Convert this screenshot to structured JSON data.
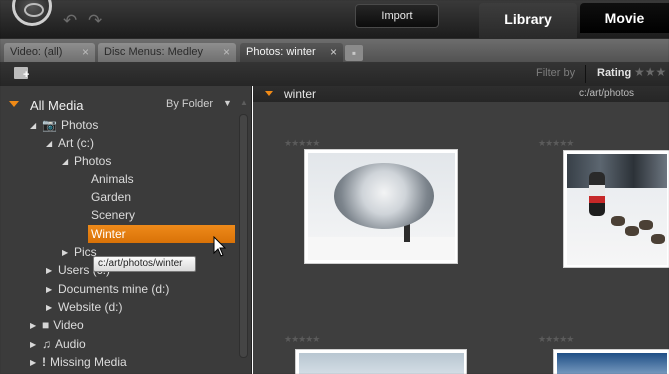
{
  "header": {
    "import_label": "Import",
    "tabs": [
      {
        "label": "Library",
        "active": true
      },
      {
        "label": "Movie",
        "active": false
      }
    ],
    "logo_icon": "app-logo-icon",
    "undo_icon": "undo-icon",
    "redo_icon": "redo-icon"
  },
  "library_tabs": [
    {
      "label": "Video: (all)",
      "active": false
    },
    {
      "label": "Disc Menus: Medley",
      "active": false
    },
    {
      "label": "Photos: winter",
      "active": true
    }
  ],
  "toolbar": {
    "filter_label": "Filter by",
    "rating_label": "Rating",
    "rating_stars": "★★★"
  },
  "tree": {
    "root_label": "All Media",
    "view_mode": "By Folder",
    "items": [
      {
        "label": "Photos",
        "icon": "camera-icon"
      },
      {
        "label": "Art (c:)"
      },
      {
        "label": "Photos"
      },
      {
        "label": "Animals"
      },
      {
        "label": "Garden"
      },
      {
        "label": "Scenery"
      },
      {
        "label": "Winter",
        "selected": true
      },
      {
        "label": "Pics"
      },
      {
        "label": "Users (c:)"
      },
      {
        "label": "Documents mine (d:)"
      },
      {
        "label": "Website (d:)"
      },
      {
        "label": "Video",
        "icon": "video-icon"
      },
      {
        "label": "Audio",
        "icon": "music-note-icon"
      },
      {
        "label": "Missing Media",
        "icon": "exclamation-icon"
      }
    ],
    "tooltip": "c:/art/photos/winter"
  },
  "content": {
    "folder_name": "winter",
    "folder_path": "c:/art/photos",
    "rating_stars": "★★★★★"
  },
  "colors": {
    "accent": "#ee8a1a",
    "panel_bg": "#3b3b3b",
    "content_bg": "#3e3e3e"
  }
}
